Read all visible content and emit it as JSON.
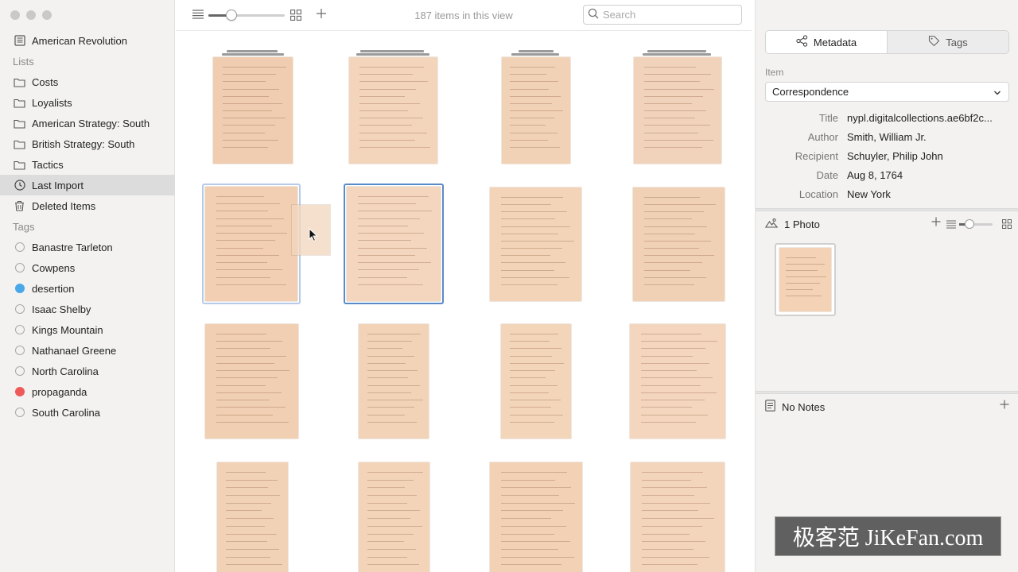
{
  "sidebar": {
    "library_title": "American Revolution",
    "lists_heading": "Lists",
    "lists": [
      {
        "label": "Costs"
      },
      {
        "label": "Loyalists"
      },
      {
        "label": "American Strategy: South"
      },
      {
        "label": "British Strategy: South"
      },
      {
        "label": "Tactics"
      }
    ],
    "last_import": "Last Import",
    "deleted_items": "Deleted Items",
    "tags_heading": "Tags",
    "tags": [
      {
        "label": "Banastre Tarleton",
        "color": ""
      },
      {
        "label": "Cowpens",
        "color": ""
      },
      {
        "label": "desertion",
        "color": "#4aa8e8"
      },
      {
        "label": "Isaac Shelby",
        "color": ""
      },
      {
        "label": "Kings Mountain",
        "color": ""
      },
      {
        "label": "Nathanael Greene",
        "color": ""
      },
      {
        "label": "North Carolina",
        "color": ""
      },
      {
        "label": "propaganda",
        "color": "#ee5a5a"
      },
      {
        "label": "South Carolina",
        "color": ""
      }
    ]
  },
  "toolbar": {
    "item_count": "187 items in this view",
    "search_placeholder": "Search",
    "zoom_level": 0.3
  },
  "inspector": {
    "tabs": {
      "metadata": "Metadata",
      "tags": "Tags"
    },
    "item_label": "Item",
    "item_type": "Correspondence",
    "fields": [
      {
        "key": "Title",
        "value": "nypl.digitalcollections.ae6bf2c..."
      },
      {
        "key": "Author",
        "value": "Smith, William Jr."
      },
      {
        "key": "Recipient",
        "value": "Schuyler, Philip John"
      },
      {
        "key": "Date",
        "value": "Aug 8, 1764"
      },
      {
        "key": "Location",
        "value": "New York"
      }
    ],
    "photos_label": "1 Photo",
    "photo_zoom_level": 0.3,
    "notes_label": "No Notes"
  },
  "watermark": "极客范 JiKeFan.com",
  "colors": {
    "accent": "#5a8ac9",
    "paper": "#f2d3b8"
  }
}
